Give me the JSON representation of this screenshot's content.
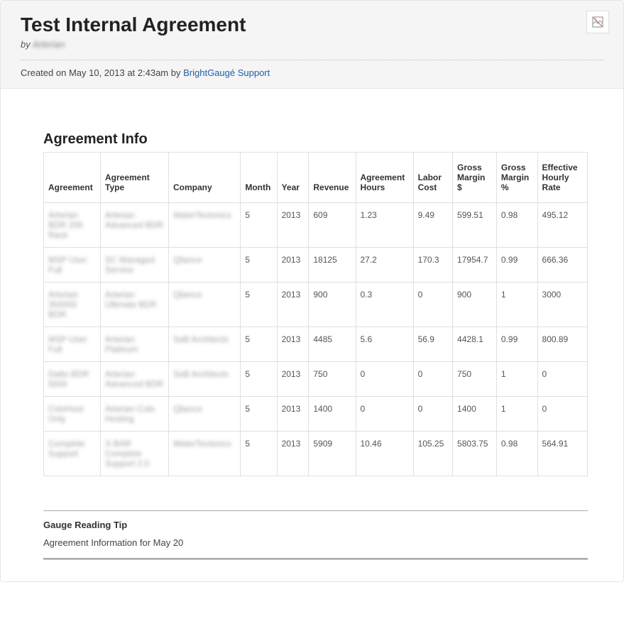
{
  "header": {
    "title": "Test Internal Agreement",
    "by_prefix": "by ",
    "by_author": "Arterian",
    "created_prefix": "Created on ",
    "created_date": "May 10, 2013 at 2:43am",
    "created_by_word": " by ",
    "created_by_link": "BrightGaugé Support"
  },
  "section": {
    "title": "Agreement Info"
  },
  "table": {
    "headers": {
      "agreement": "Agreement",
      "type": "Agreement Type",
      "company": "Company",
      "month": "Month",
      "year": "Year",
      "revenue": "Revenue",
      "hours": "Agreement Hours",
      "labor": "Labor Cost",
      "gmargin": "Gross Margin $",
      "gmarginp": "Gross Margin %",
      "rate": "Effective Hourly Rate"
    },
    "rows": [
      {
        "agreement": "Arterian BDR 200 Rack",
        "type": "Arterian Advanced BDR",
        "company": "WaterTectonics",
        "month": "5",
        "year": "2013",
        "revenue": "609",
        "hours": "1.23",
        "labor": "9.49",
        "gmargin": "599.51",
        "gmarginp": "0.98",
        "rate": "495.12"
      },
      {
        "agreement": "MSP User Full",
        "type": "SC Managed Service",
        "company": "Qliance",
        "month": "5",
        "year": "2013",
        "revenue": "18125",
        "hours": "27.2",
        "labor": "170.3",
        "gmargin": "17954.7",
        "gmarginp": "0.99",
        "rate": "666.36"
      },
      {
        "agreement": "Arterian 350000 BDR",
        "type": "Arterian Ultimate BDR",
        "company": "Qliance",
        "month": "5",
        "year": "2013",
        "revenue": "900",
        "hours": "0.3",
        "labor": "0",
        "gmargin": "900",
        "gmarginp": "1",
        "rate": "3000"
      },
      {
        "agreement": "MSP User Full",
        "type": "Arterian Platinum",
        "company": "SaB Architects",
        "month": "5",
        "year": "2013",
        "revenue": "4485",
        "hours": "5.6",
        "labor": "56.9",
        "gmargin": "4428.1",
        "gmarginp": "0.99",
        "rate": "800.89"
      },
      {
        "agreement": "Datto BDR 5000",
        "type": "Arterian Advanced BDR",
        "company": "SaB Architects",
        "month": "5",
        "year": "2013",
        "revenue": "750",
        "hours": "0",
        "labor": "0",
        "gmargin": "750",
        "gmarginp": "1",
        "rate": "0"
      },
      {
        "agreement": "ColoHost Only",
        "type": "Arterian Colo Hosting",
        "company": "Qliance",
        "month": "5",
        "year": "2013",
        "revenue": "1400",
        "hours": "0",
        "labor": "0",
        "gmargin": "1400",
        "gmarginp": "1",
        "rate": "0"
      },
      {
        "agreement": "Complete Support",
        "type": "X-BAR Complete Support 2.0",
        "company": "WaterTectonics",
        "month": "5",
        "year": "2013",
        "revenue": "5909",
        "hours": "10.46",
        "labor": "105.25",
        "gmargin": "5803.75",
        "gmarginp": "0.98",
        "rate": "564.91"
      }
    ]
  },
  "tip": {
    "title": "Gauge Reading Tip",
    "text": "Agreement Information for May 20"
  }
}
